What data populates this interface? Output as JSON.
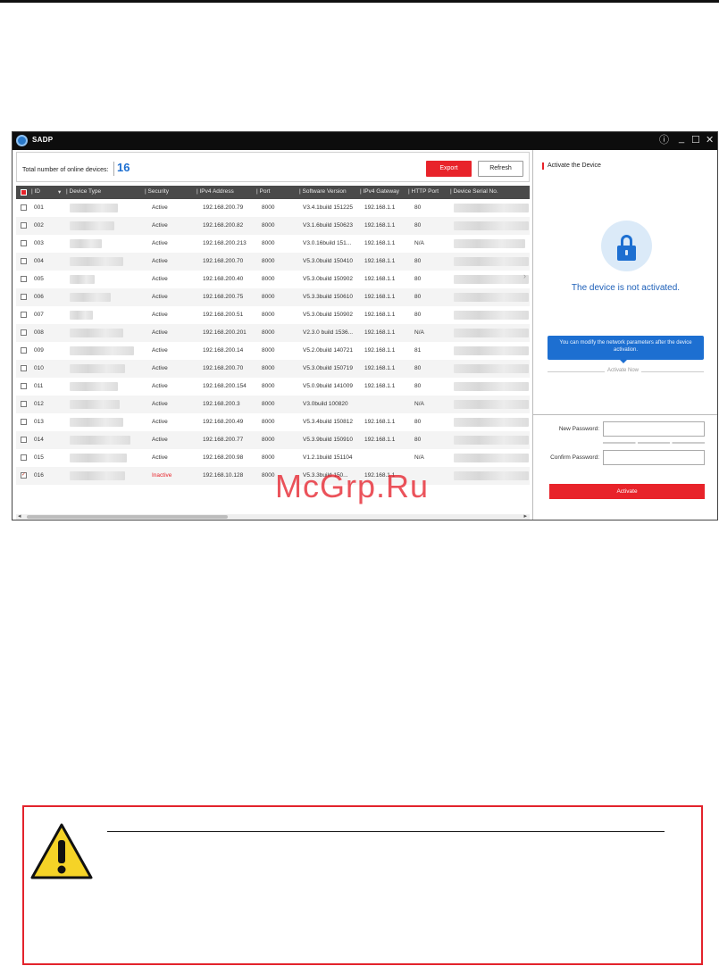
{
  "window": {
    "title": "SADP",
    "controls": {
      "info": "ⓘ",
      "minimize": "_",
      "maximize": "☐",
      "close": "✕"
    }
  },
  "summary": {
    "label": "Total number of online devices:",
    "count": "16",
    "export_label": "Export",
    "refresh_label": "Refresh"
  },
  "table": {
    "columns": [
      "ID",
      "Device Type",
      "Security",
      "IPv4 Address",
      "Port",
      "Software Version",
      "IPv4 Gateway",
      "HTTP Port",
      "Device Serial No."
    ],
    "rows": [
      {
        "id": "001",
        "security": "Active",
        "ip": "192.168.200.79",
        "port": "8000",
        "version": "V3.4.1build 151225",
        "gateway": "192.168.1.1",
        "http": "80",
        "checked": false
      },
      {
        "id": "002",
        "security": "Active",
        "ip": "192.168.200.82",
        "port": "8000",
        "version": "V3.1.6build 150623",
        "gateway": "192.168.1.1",
        "http": "80",
        "checked": false
      },
      {
        "id": "003",
        "security": "Active",
        "ip": "192.168.200.213",
        "port": "8000",
        "version": "V3.0.16build 151...",
        "gateway": "192.168.1.1",
        "http": "N/A",
        "checked": false
      },
      {
        "id": "004",
        "security": "Active",
        "ip": "192.168.200.70",
        "port": "8000",
        "version": "V5.3.0build 150410",
        "gateway": "192.168.1.1",
        "http": "80",
        "checked": false
      },
      {
        "id": "005",
        "security": "Active",
        "ip": "192.168.200.40",
        "port": "8000",
        "version": "V5.3.0build 150902",
        "gateway": "192.168.1.1",
        "http": "80",
        "checked": false
      },
      {
        "id": "006",
        "security": "Active",
        "ip": "192.168.200.75",
        "port": "8000",
        "version": "V5.3.3build 150610",
        "gateway": "192.168.1.1",
        "http": "80",
        "checked": false
      },
      {
        "id": "007",
        "security": "Active",
        "ip": "192.168.200.51",
        "port": "8000",
        "version": "V5.3.0build 150902",
        "gateway": "192.168.1.1",
        "http": "80",
        "checked": false
      },
      {
        "id": "008",
        "security": "Active",
        "ip": "192.168.200.201",
        "port": "8000",
        "version": "V2.3.0 build 1536...",
        "gateway": "192.168.1.1",
        "http": "N/A",
        "checked": false
      },
      {
        "id": "009",
        "security": "Active",
        "ip": "192.168.200.14",
        "port": "8000",
        "version": "V5.2.0build 140721",
        "gateway": "192.168.1.1",
        "http": "81",
        "checked": false
      },
      {
        "id": "010",
        "security": "Active",
        "ip": "192.168.200.70",
        "port": "8000",
        "version": "V5.3.0build 150719",
        "gateway": "192.168.1.1",
        "http": "80",
        "checked": false
      },
      {
        "id": "011",
        "security": "Active",
        "ip": "192.168.200.154",
        "port": "8000",
        "version": "V5.0.9build 141009",
        "gateway": "192.168.1.1",
        "http": "80",
        "checked": false
      },
      {
        "id": "012",
        "security": "Active",
        "ip": "192.168.200.3",
        "port": "8000",
        "version": "V3.0build 100820",
        "gateway": "",
        "http": "N/A",
        "checked": false
      },
      {
        "id": "013",
        "security": "Active",
        "ip": "192.168.200.49",
        "port": "8000",
        "version": "V5.3.4build 150812",
        "gateway": "192.168.1.1",
        "http": "80",
        "checked": false
      },
      {
        "id": "014",
        "security": "Active",
        "ip": "192.168.200.77",
        "port": "8000",
        "version": "V5.3.9build 150910",
        "gateway": "192.168.1.1",
        "http": "80",
        "checked": false
      },
      {
        "id": "015",
        "security": "Active",
        "ip": "192.168.200.98",
        "port": "8000",
        "version": "V1.2.1build 151104",
        "gateway": "",
        "http": "N/A",
        "checked": false
      },
      {
        "id": "016",
        "security": "Inactive",
        "ip": "192.168.10.128",
        "port": "8000",
        "version": "V5.3.3build 150...",
        "gateway": "192.168.1.1",
        "http": "",
        "checked": true
      }
    ]
  },
  "activate_panel": {
    "title": "Activate the Device",
    "status": "The device is not activated.",
    "tooltip": "You can modify the network parameters after the device activation.",
    "activate_now": "Activate Now",
    "new_password_label": "New Password:",
    "confirm_password_label": "Confirm Password:",
    "activate_button": "Activate"
  },
  "watermark": "McGrp.Ru",
  "colors": {
    "accent_red": "#e8232a",
    "accent_blue": "#1d6fd1",
    "titlebar": "#0d0d0d",
    "header_row": "#4a4a4a",
    "warning_yellow": "#f5d327"
  },
  "icons": [
    "app-logo-icon",
    "lock-icon",
    "warning-triangle-icon",
    "chevron-right-icon"
  ]
}
